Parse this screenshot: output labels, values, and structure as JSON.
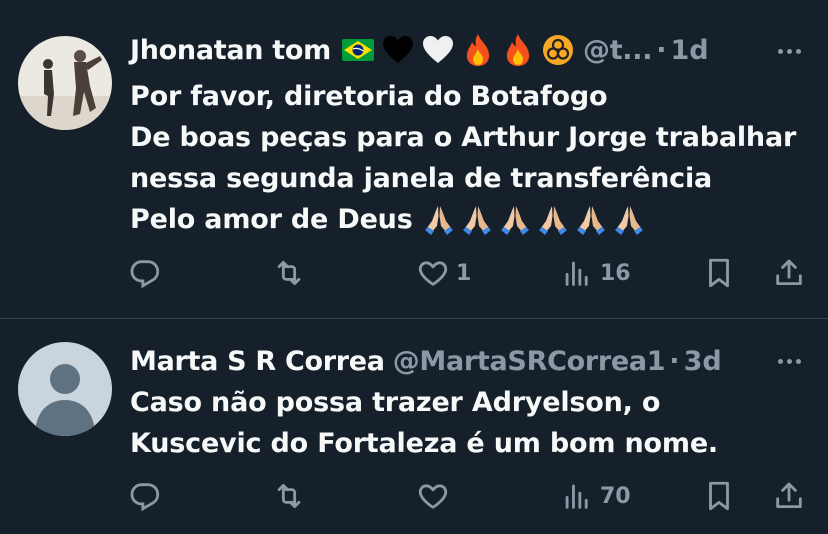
{
  "tweets": [
    {
      "name": "Jhonatan tom",
      "name_emojis": [
        "brazil-flag",
        "black-heart",
        "white-heart",
        "fire",
        "fire",
        "biohazard"
      ],
      "handle": "@t...",
      "dot": "·",
      "time": "1d",
      "lines": [
        "Por favor, diretoria do Botafogo",
        "De boas peças para o Arthur Jorge trabalhar",
        "nessa segunda janela de transferência",
        "Pelo amor de Deus"
      ],
      "trailing_emojis": [
        "folded-hands",
        "folded-hands",
        "folded-hands",
        "folded-hands",
        "folded-hands",
        "folded-hands"
      ],
      "actions": {
        "replies": "",
        "reposts": "",
        "likes": "1",
        "views": "16"
      }
    },
    {
      "name": "Marta S R Correa",
      "handle": "@MartaSRCorrea1",
      "dot": "·",
      "time": "3d",
      "lines": [
        "Caso não possa trazer Adryelson, o",
        "Kuscevic do Fortaleza é um bom nome."
      ],
      "actions": {
        "replies": "",
        "reposts": "",
        "likes": "",
        "views": "70"
      }
    }
  ],
  "colors": {
    "background": "#15202b",
    "text": "#f7f9f9",
    "muted": "#8b98a5",
    "divider": "#38444d"
  }
}
